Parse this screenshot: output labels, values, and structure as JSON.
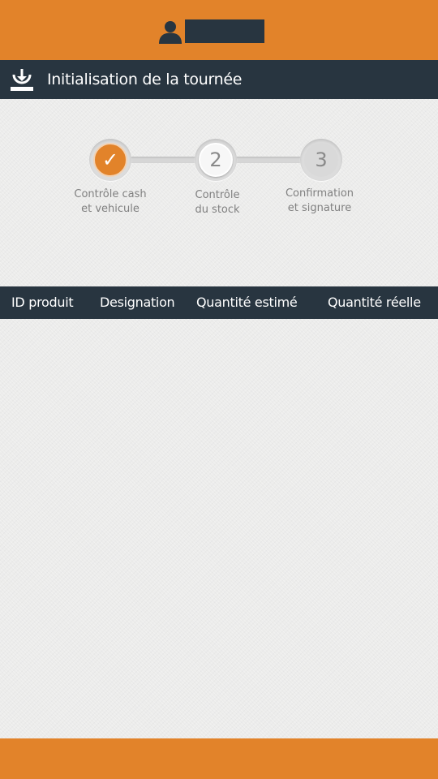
{
  "header": {
    "user_name": "",
    "icon": "user-icon",
    "color": "#e2832a"
  },
  "title_bar": {
    "icon": "download-tray-icon",
    "title": "Initialisation de la tournée",
    "color": "#283540"
  },
  "steps": [
    {
      "number": "✓",
      "line1": "Contrôle cash",
      "line2": "et vehicule",
      "state": "done"
    },
    {
      "number": "2",
      "line1": "Contrôle",
      "line2": "du stock",
      "state": "active"
    },
    {
      "number": "3",
      "line1": "Confirmation",
      "line2": "et signature",
      "state": "pending"
    }
  ],
  "table": {
    "columns": [
      "ID produit",
      "Designation",
      "Quantité estimé",
      "Quantité réelle"
    ],
    "rows": []
  },
  "footer": {
    "color": "#e2832a"
  }
}
